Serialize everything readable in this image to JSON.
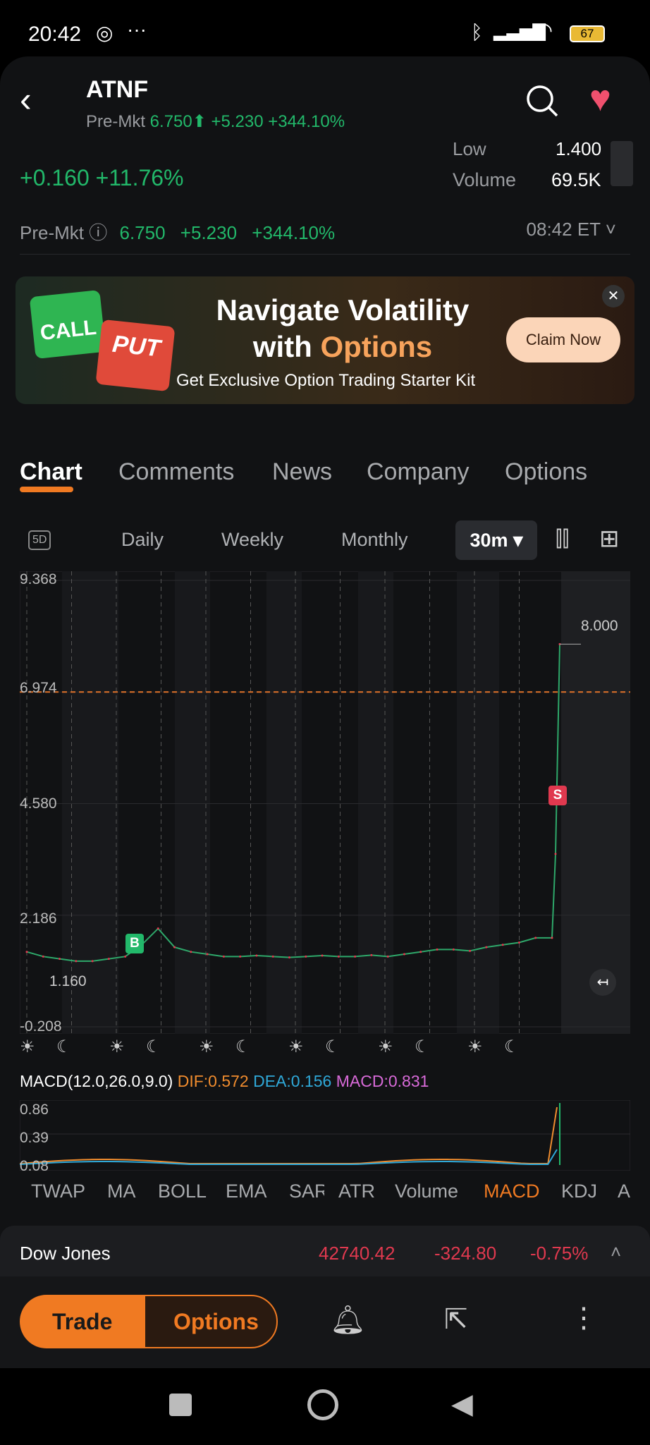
{
  "status": {
    "time": "20:42",
    "battery": "67"
  },
  "header": {
    "symbol": "ATNF",
    "premkt_label": "Pre-Mkt",
    "premkt_price": "6.750",
    "premkt_change": "+5.230",
    "premkt_pct": "+344.10%"
  },
  "quote": {
    "change": "+0.160",
    "pct": "+11.76%",
    "low_label": "Low",
    "low_value": "1.400",
    "volume_label": "Volume",
    "volume_value": "69.5K"
  },
  "premkt_row": {
    "label": "Pre-Mkt",
    "price": "6.750",
    "change": "+5.230",
    "pct": "+344.10%",
    "time": "08:42 ET"
  },
  "banner": {
    "call": "CALL",
    "put": "PUT",
    "title1": "Navigate Volatility",
    "title2a": "with ",
    "title2b": "Options",
    "subtitle": "Get Exclusive Option Trading Starter Kit",
    "cta": "Claim Now"
  },
  "tabs": [
    "Chart",
    "Comments",
    "News",
    "Company",
    "Options"
  ],
  "periods": {
    "icon5d": "5D",
    "items": [
      "Daily",
      "Weekly",
      "Monthly"
    ],
    "selected": "30m"
  },
  "chart_data": {
    "type": "line",
    "y_ticks": [
      "9.368",
      "6.974",
      "4.580",
      "2.186",
      "-0.208"
    ],
    "ylim": [
      -0.208,
      9.368
    ],
    "high_label": "8.000",
    "low_label": "1.160",
    "ref_line": 6.974,
    "markers": {
      "buy": "B",
      "sell": "S"
    },
    "values": [
      1.4,
      1.3,
      1.25,
      1.2,
      1.2,
      1.25,
      1.3,
      1.55,
      1.9,
      1.5,
      1.4,
      1.35,
      1.3,
      1.3,
      1.32,
      1.3,
      1.28,
      1.3,
      1.32,
      1.3,
      1.3,
      1.33,
      1.3,
      1.35,
      1.4,
      1.45,
      1.45,
      1.42,
      1.5,
      1.55,
      1.6,
      1.7,
      1.7,
      3.5,
      8.0
    ]
  },
  "macd": {
    "label": "MACD(12.0,26.0,9.0)",
    "dif": "DIF:0.572",
    "dea": "DEA:0.156",
    "macd": "MACD:0.831",
    "y_ticks": [
      "0.86",
      "0.39",
      "0.08"
    ]
  },
  "indicators": [
    "TWAP",
    "MA",
    "BOLL",
    "EMA",
    "SAR",
    "ATR",
    "Volume",
    "MACD",
    "KDJ",
    "A"
  ],
  "index": {
    "name": "Dow Jones",
    "value": "42740.42",
    "change": "-324.80",
    "pct": "-0.75%"
  },
  "bottom": {
    "trade": "Trade",
    "options": "Options"
  }
}
